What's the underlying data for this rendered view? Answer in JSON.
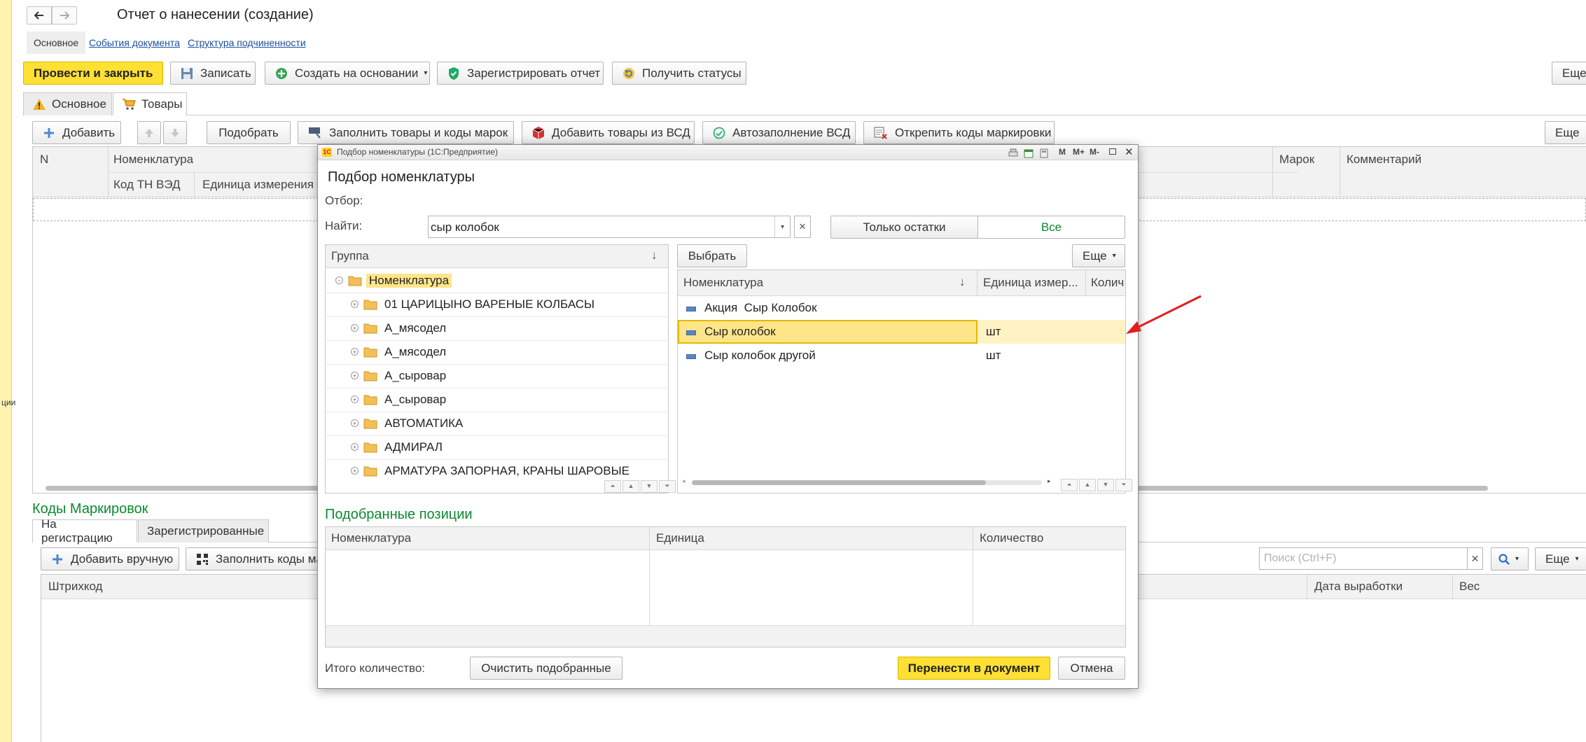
{
  "window": {
    "title": "Отчет о нанесении (создание)",
    "nav_back_icon": "arrow-left-icon",
    "nav_forward_icon": "arrow-right-icon",
    "left_text": "ции"
  },
  "doc_tabs": [
    "Основное",
    "События документа",
    "Структура подчиненности"
  ],
  "toolbar": {
    "post_close": "Провести и закрыть",
    "save": "Записать",
    "create_based": "Создать на основании",
    "register_report": "Зарегистрировать отчет",
    "get_statuses": "Получить статусы",
    "more": "Еще"
  },
  "main_tabs": [
    "Основное",
    "Товары"
  ],
  "goods_toolbar": {
    "add": "Добавить",
    "pick": "Подобрать",
    "fill_goods_codes": "Заполнить товары и коды марок",
    "add_from_vsd": "Добавить товары из ВСД",
    "autofill_vsd": "Автозаполнение ВСД",
    "unpin_codes": "Открепить коды маркировки",
    "more": "Еще"
  },
  "goods_table": {
    "col_n": "N",
    "col_nomenclature": "Номенклатура",
    "col_tnved": "Код ТН ВЭД",
    "col_unit": "Единица измерения",
    "col_marks": "Марок",
    "col_comment": "Комментарий"
  },
  "codes_section": {
    "title": "Коды Маркировок",
    "tabs": [
      "На регистрацию",
      "Зарегистрированные"
    ],
    "add_manual": "Добавить вручную",
    "fill_codes": "Заполнить коды ма",
    "search_placeholder": "Поиск (Ctrl+F)",
    "more": "Еще",
    "col_barcode": "Штрихкод",
    "col_prod_date": "Дата выработки",
    "col_weight": "Вес"
  },
  "dialog": {
    "titlebar": "Подбор номенклатуры (1С:Предприятие)",
    "titlebar_buttons": [
      "M",
      "M+",
      "M-"
    ],
    "heading": "Подбор номенклатуры",
    "filter_label": "Отбор:",
    "find_label": "Найти:",
    "find_value": "сыр колобок",
    "only_rest": "Только остатки",
    "all": "Все",
    "group_header": "Группа",
    "group_root": "Номенклатура",
    "groups": [
      "01 ЦАРИЦЫНО ВАРЕНЫЕ КОЛБАСЫ",
      "А_мясодел",
      "А_мясодел",
      "А_сыровар",
      "А_сыровар",
      "АВТОМАТИКА",
      "АДМИРАЛ",
      "АРМАТУРА ЗАПОРНАЯ, КРАНЫ ШАРОВЫЕ"
    ],
    "choose": "Выбрать",
    "more": "Еще",
    "items_header": {
      "nomenclature": "Номенклатура",
      "unit": "Единица измер...",
      "qty": "Колич"
    },
    "items": [
      {
        "name": "Акция  Сыр Колобок",
        "unit": ""
      },
      {
        "name": "Сыр колобок",
        "unit": "шт"
      },
      {
        "name": "Сыр колобок другой",
        "unit": "шт"
      }
    ],
    "picked_title": "Подобранные позиции",
    "picked_header": {
      "nomenclature": "Номенклатура",
      "unit": "Единица",
      "qty": "Количество"
    },
    "total_label": "Итого количество:",
    "clear_picked": "Очистить подобранные",
    "transfer": "Перенести в документ",
    "cancel": "Отмена"
  },
  "colors": {
    "accent_yellow": "#ffe033",
    "selection_yellow": "#ffe58a",
    "section_green": "#0a8a2e",
    "annotation_red": "#e02020"
  }
}
